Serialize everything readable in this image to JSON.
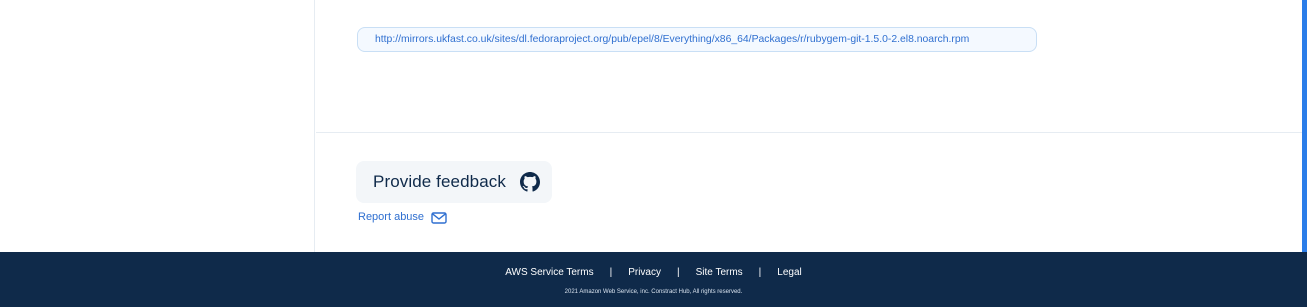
{
  "artifact": {
    "url": "http://mirrors.ukfast.co.uk/sites/dl.fedoraproject.org/pub/epel/8/Everything/x86_64/Packages/r/rubygem-git-1.5.0-2.el8.noarch.rpm"
  },
  "feedback": {
    "button_label": "Provide feedback",
    "button_icon": "github-icon",
    "report_label": "Report abuse",
    "report_icon": "mail-icon"
  },
  "footer": {
    "links": [
      "AWS Service Terms",
      "Privacy",
      "Site Terms",
      "Legal"
    ],
    "separator": "|",
    "copyright": "2021 Amazon Web Service, inc. Constract Hub, All rights reserved."
  },
  "colors": {
    "footer_bg": "#0f2a4a",
    "link": "#2f6fd0",
    "accent": "#2b7de9"
  }
}
